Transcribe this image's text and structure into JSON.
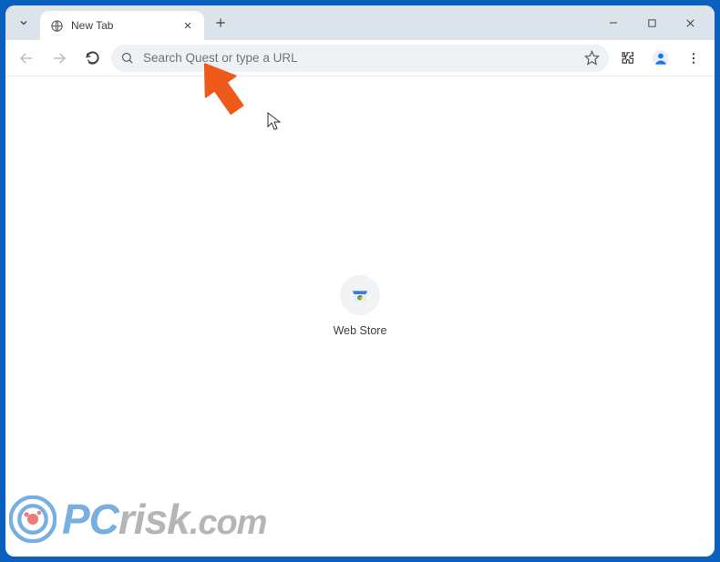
{
  "tab": {
    "title": "New Tab"
  },
  "omnibox": {
    "placeholder": "Search Quest or type a URL"
  },
  "shortcuts": [
    {
      "label": "Web Store"
    }
  ],
  "watermark": {
    "pc": "PC",
    "risk": "risk",
    "dotcom": ".com"
  }
}
